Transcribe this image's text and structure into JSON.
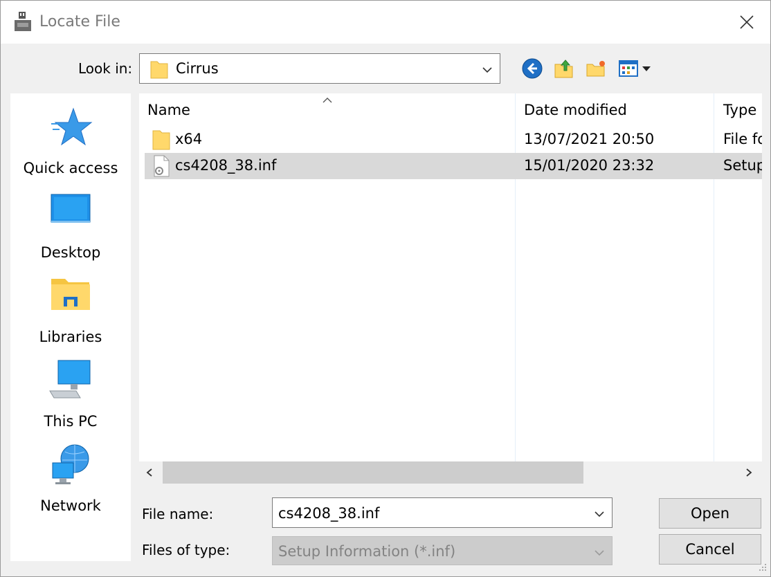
{
  "window": {
    "title": "Locate File",
    "close_icon": "close-icon"
  },
  "lookin": {
    "label": "Look in:",
    "value": "Cirrus"
  },
  "toolbar": [
    "back-icon",
    "up-folder-icon",
    "new-folder-icon",
    "view-menu-icon"
  ],
  "places": [
    {
      "label": "Quick access",
      "icon": "quick-access-star-icon"
    },
    {
      "label": "Desktop",
      "icon": "desktop-icon"
    },
    {
      "label": "Libraries",
      "icon": "libraries-icon"
    },
    {
      "label": "This PC",
      "icon": "this-pc-icon"
    },
    {
      "label": "Network",
      "icon": "network-icon"
    }
  ],
  "columns": {
    "name": "Name",
    "date": "Date modified",
    "type": "Type"
  },
  "files": [
    {
      "name": "x64",
      "date": "13/07/2021 20:50",
      "type": "File fo",
      "icon": "folder-icon",
      "selected": false
    },
    {
      "name": "cs4208_38.inf",
      "date": "15/01/2020 23:32",
      "type": "Setup",
      "icon": "setup-file-icon",
      "selected": true
    }
  ],
  "form": {
    "filename_label": "File name:",
    "filename_value": "cs4208_38.inf",
    "filetype_label": "Files of type:",
    "filetype_value": "Setup Information (*.inf)"
  },
  "buttons": {
    "open": "Open",
    "cancel": "Cancel"
  },
  "colors": {
    "folder": "#ffd86b",
    "accent": "#0078d7",
    "selection": "#d9d9d9"
  }
}
